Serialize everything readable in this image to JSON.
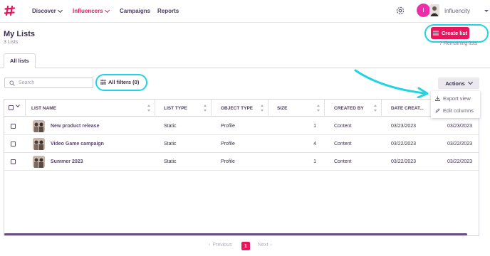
{
  "nav": {
    "items": [
      {
        "label": "Discover",
        "has_dropdown": true,
        "active": false
      },
      {
        "label": "Influencers",
        "has_dropdown": true,
        "active": true
      },
      {
        "label": "Campaigns",
        "has_dropdown": false,
        "active": false
      },
      {
        "label": "Reports",
        "has_dropdown": false,
        "active": false
      }
    ],
    "avatar_initial": "I",
    "org_name": "Influencity"
  },
  "header": {
    "title": "My Lists",
    "subtitle": "3 Lists",
    "create_label": "Create list",
    "remaining": "7 Remaining lists"
  },
  "tabs": [
    {
      "label": "All lists",
      "active": true
    }
  ],
  "toolbar": {
    "search_placeholder": "Search",
    "filters_label": "All filters (0)",
    "actions_label": "Actions"
  },
  "actions_menu": [
    "Export view",
    "Edit columns"
  ],
  "table": {
    "columns": [
      "LIST NAME",
      "LIST TYPE",
      "OBJECT TYPE",
      "SIZE",
      "CREATED BY",
      "DATE CREAT...",
      ""
    ],
    "rows": [
      {
        "name": "New product release",
        "type": "Static",
        "object": "Profile",
        "size": "1",
        "created_by": "Content",
        "date": "03/23/2023",
        "date2": "03/23/2023"
      },
      {
        "name": "Video Game campaign",
        "type": "Static",
        "object": "Profile",
        "size": "4",
        "created_by": "Content",
        "date": "03/22/2023",
        "date2": "03/22/2023"
      },
      {
        "name": "Summer 2023",
        "type": "Static",
        "object": "Profile",
        "size": "1",
        "created_by": "Content",
        "date": "03/22/2023",
        "date2": "03/22/2023"
      }
    ]
  },
  "pagination": {
    "prev": "Previous",
    "next": "Next",
    "current": "1"
  },
  "colors": {
    "accent": "#e8175d",
    "annotation": "#22d3e4",
    "text": "#3b2f4a"
  }
}
